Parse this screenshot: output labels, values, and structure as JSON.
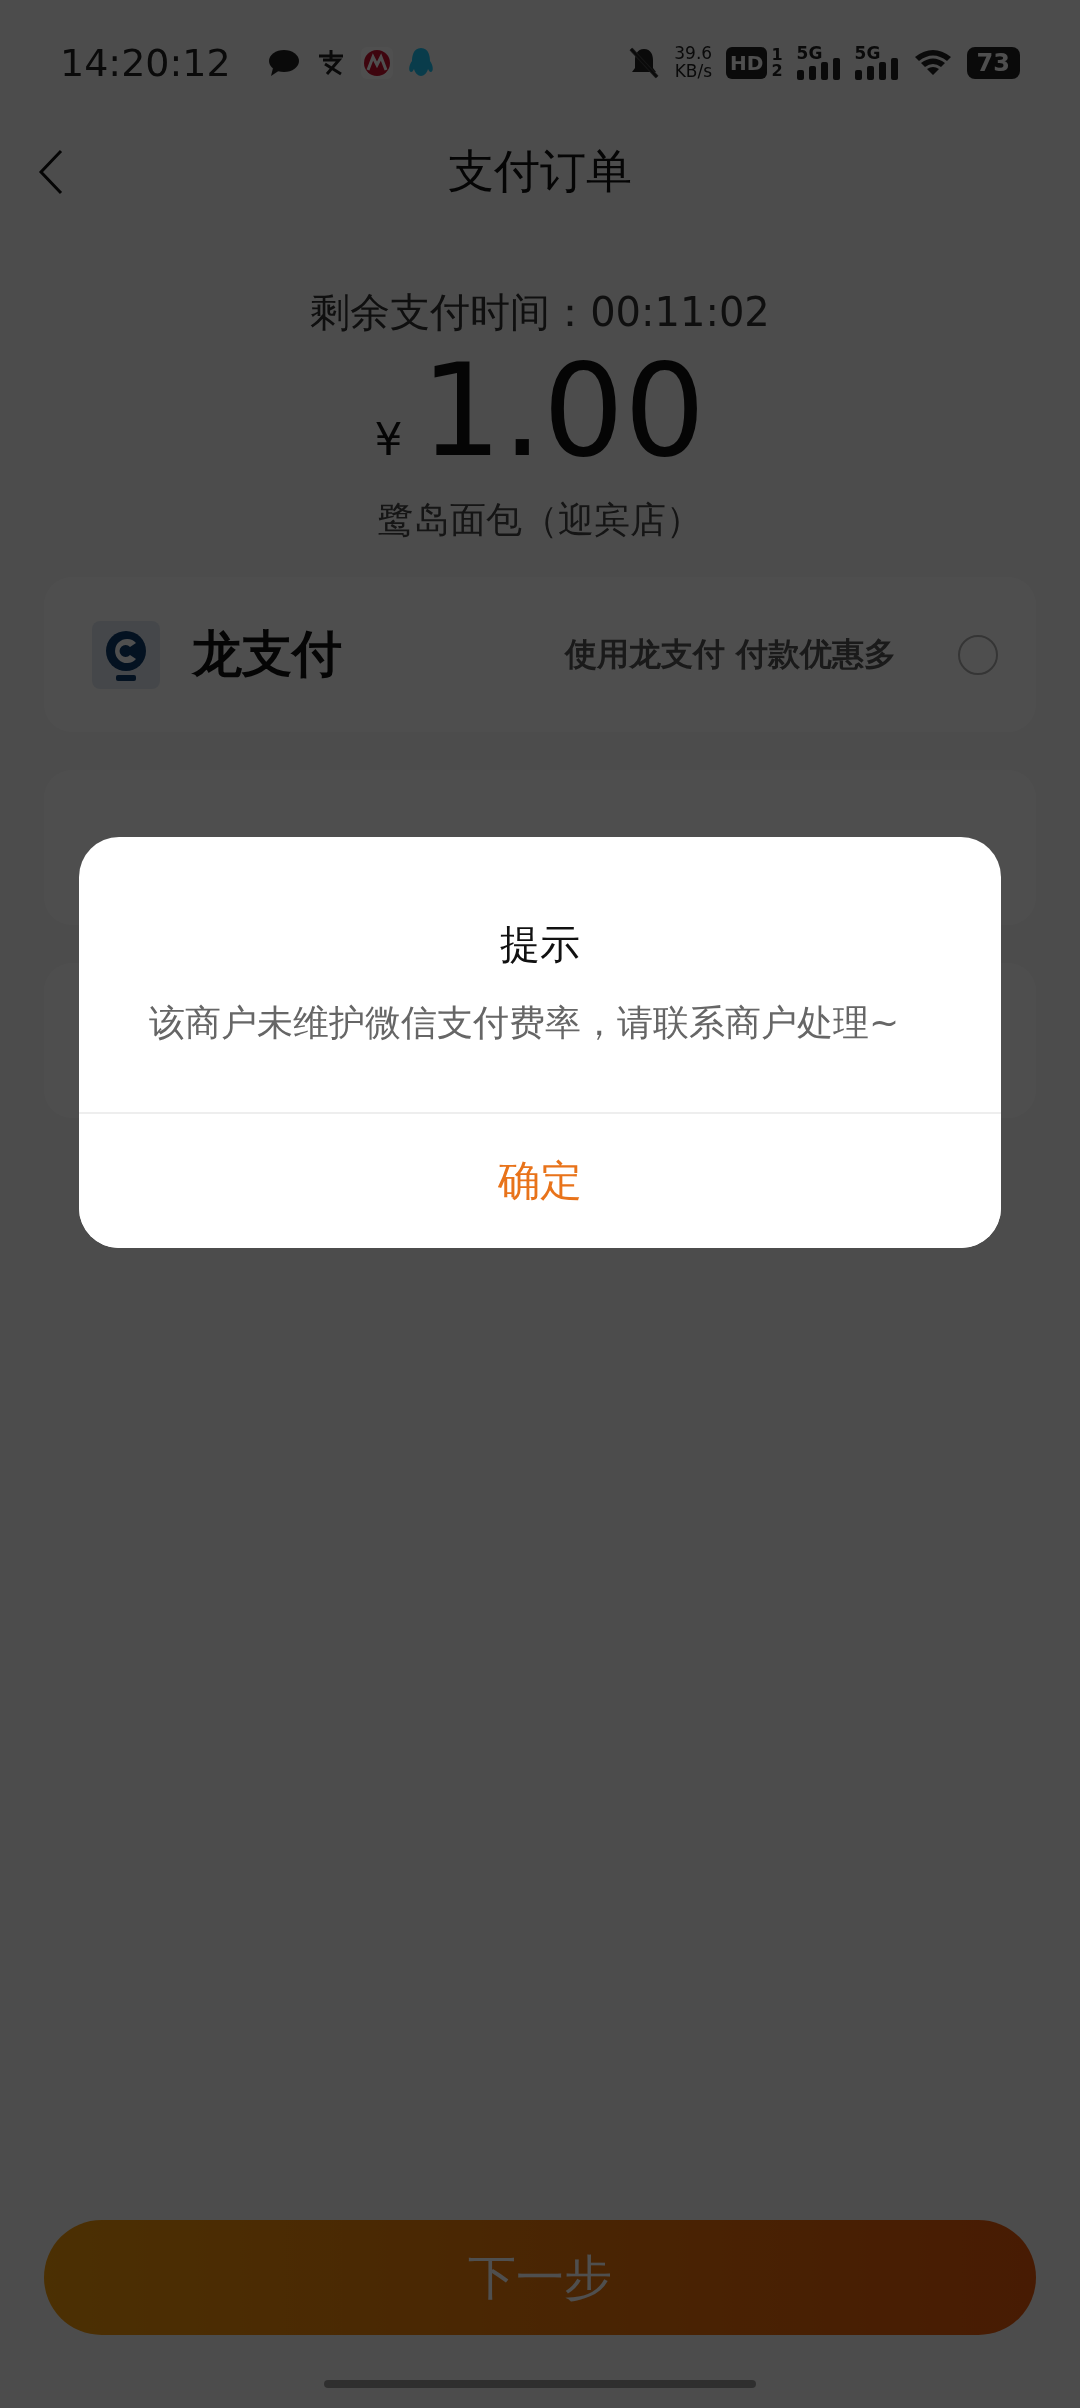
{
  "status_bar": {
    "time": "14:20:12",
    "net_speed": "39.6",
    "net_unit": "KB/s",
    "hd": "HD",
    "sim1": "1",
    "sim2": "2",
    "signals": [
      "5G",
      "5G"
    ],
    "battery": "73"
  },
  "header": {
    "title": "支付订单"
  },
  "countdown": {
    "label": "剩余支付时间：",
    "time": "00:11:02"
  },
  "amount": {
    "currency": "¥",
    "value": "1.00"
  },
  "store": "鹭岛面包（迎宾店）",
  "payment_methods": [
    {
      "name": "龙支付",
      "promo": "使用龙支付 付款优惠多",
      "selected": false
    }
  ],
  "dialog": {
    "title": "提示",
    "message": "该商户未维护微信支付费率，请联系商户处理~",
    "button": "确定"
  },
  "next_button": "下一步"
}
